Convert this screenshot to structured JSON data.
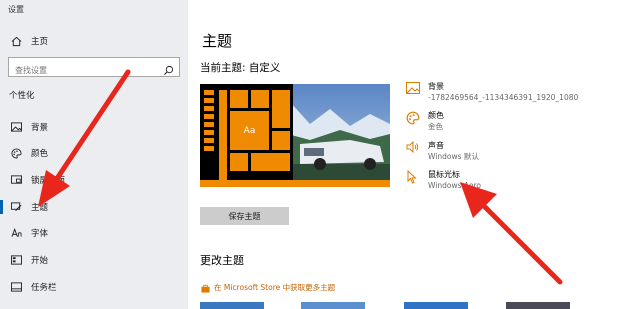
{
  "window": {
    "title": "设置"
  },
  "sidebar": {
    "home_label": "主页",
    "search_placeholder": "查找设置",
    "section": "个性化",
    "items": [
      {
        "label": "背景",
        "icon": "image-icon"
      },
      {
        "label": "颜色",
        "icon": "palette-icon"
      },
      {
        "label": "锁屏界面",
        "icon": "lockscreen-icon"
      },
      {
        "label": "主题",
        "icon": "theme-icon"
      },
      {
        "label": "字体",
        "icon": "font-icon"
      },
      {
        "label": "开始",
        "icon": "start-icon"
      },
      {
        "label": "任务栏",
        "icon": "taskbar-icon"
      }
    ],
    "active_index": 3
  },
  "main": {
    "title": "主题",
    "current_theme": "当前主题: 自定义",
    "preview_tile_text": "Aa",
    "save_button": "保存主题",
    "change_title": "更改主题",
    "store_link": "在 Microsoft Store 中获取更多主题",
    "properties": [
      {
        "title": "背景",
        "value": "-1782469564_-1134346391_1920_1080",
        "icon": "image-icon"
      },
      {
        "title": "颜色",
        "value": "金色",
        "icon": "palette-icon"
      },
      {
        "title": "声音",
        "value": "Windows 默认",
        "icon": "speaker-icon"
      },
      {
        "title": "鼠标光标",
        "value": "Windows Aero",
        "icon": "cursor-icon"
      }
    ]
  },
  "colors": {
    "accent_orange": "#f08a00",
    "arrow_red": "#e8261c",
    "link_orange": "#c46200"
  }
}
